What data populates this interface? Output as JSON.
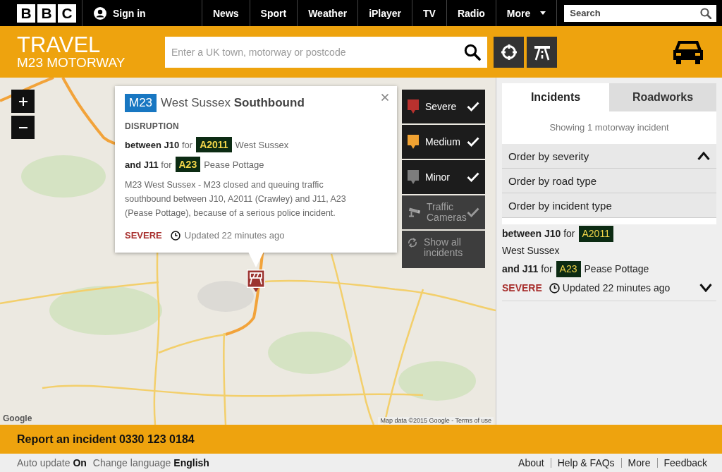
{
  "header": {
    "logo_letters": [
      "B",
      "B",
      "C"
    ],
    "sign_in": "Sign in",
    "nav": [
      {
        "label": "News",
        "dropdown": false
      },
      {
        "label": "Sport",
        "dropdown": false
      },
      {
        "label": "Weather",
        "dropdown": false
      },
      {
        "label": "iPlayer",
        "dropdown": false
      },
      {
        "label": "TV",
        "dropdown": false
      },
      {
        "label": "Radio",
        "dropdown": false
      },
      {
        "label": "More",
        "dropdown": true
      }
    ],
    "search": {
      "placeholder": "Search"
    }
  },
  "travel_bar": {
    "title": "TRAVEL",
    "subtitle": "M23 MOTORWAY",
    "search": {
      "placeholder": "Enter a UK town, motorway or postcode"
    }
  },
  "map": {
    "popup": {
      "road": "M23",
      "title": "West Sussex **Southbound**",
      "category": "DISRUPTION",
      "lines": [
        {
          "junction": "**between J10** for",
          "road": "A2011",
          "place": "West Sussex"
        },
        {
          "junction": "**and J11** for",
          "road": "A23",
          "place": "Pease Pottage"
        }
      ],
      "description": "M23 West Sussex - M23 closed and queuing traffic southbound between J10, A2011 (Crawley) and J11, A23 (Pease Pottage), because of a serious police incident.",
      "severity": "SEVERE",
      "updated": "Updated 22 minutes ago"
    },
    "legend": [
      {
        "kind": "severity",
        "label": "Severe",
        "color": "#b8312e",
        "checked": true,
        "disabled": false
      },
      {
        "kind": "severity",
        "label": "Medium",
        "color": "#f0a232",
        "checked": true,
        "disabled": false
      },
      {
        "kind": "severity",
        "label": "Minor",
        "color": "#7d7d7d",
        "checked": true,
        "disabled": false
      },
      {
        "kind": "camera",
        "label": "Traffic Cameras",
        "checked": true,
        "disabled": true
      },
      {
        "kind": "reset",
        "label": "Show all incidents",
        "checked": false,
        "disabled": true
      }
    ],
    "attribution": "Map data ©2015 Google - Terms of use",
    "logo": "Google"
  },
  "panel": {
    "tabs": [
      {
        "label": "Incidents",
        "selected": true
      },
      {
        "label": "Roadworks",
        "selected": false
      }
    ],
    "summary": "Showing 1 motorway incident",
    "sort_menu": {
      "expanded": true,
      "options": [
        "Order by severity",
        "Order by road type",
        "Order by incident type"
      ]
    },
    "incident": {
      "lines": [
        {
          "junction": "**between J10** for",
          "road": "A2011",
          "place": "West Sussex"
        },
        {
          "junction": "**and J11** for",
          "road": "A23",
          "place": "Pease Pottage"
        }
      ],
      "severity": "SEVERE",
      "updated": "Updated 22 minutes ago",
      "expanded": false
    }
  },
  "report_bar": {
    "text": "Report an incident 0330 123 0184"
  },
  "footer": {
    "settings": [
      "Auto update **On**",
      "Change language **English**"
    ],
    "links": [
      "About",
      "Help & FAQs",
      "More",
      "Feedback"
    ]
  }
}
